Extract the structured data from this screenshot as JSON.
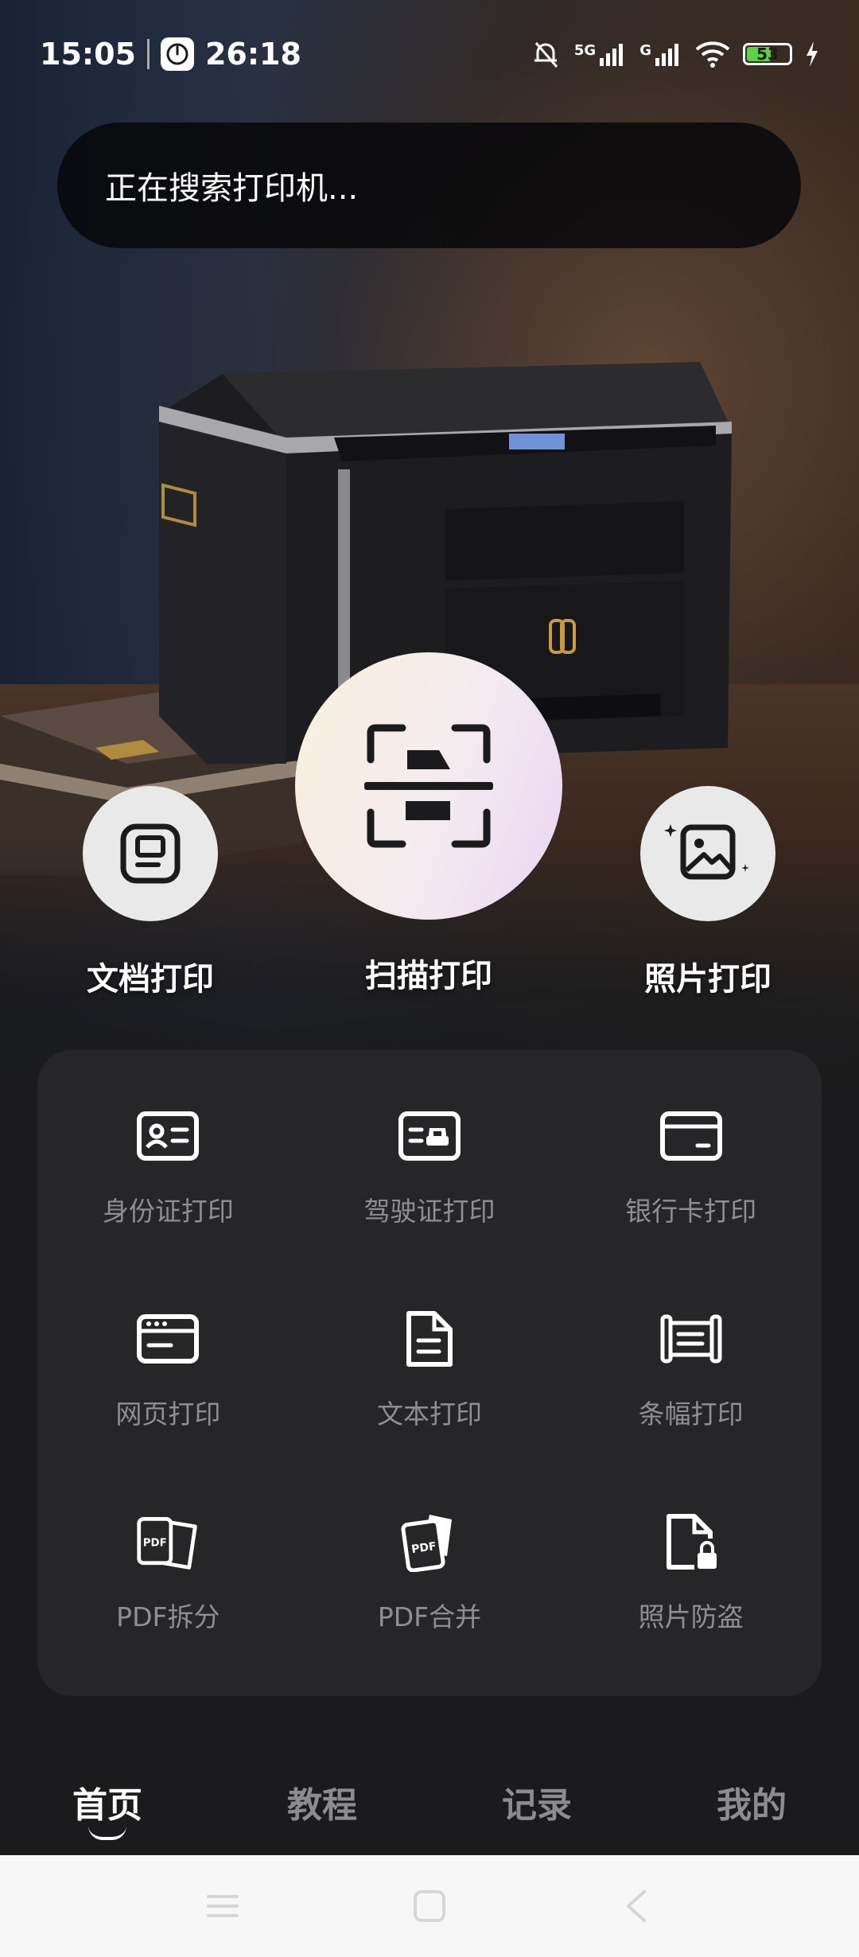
{
  "status_bar": {
    "time": "15:05",
    "timer": "26:18",
    "network_5g": "5G",
    "network_g": "G",
    "battery_level": "53",
    "battery_fraction": 0.53
  },
  "search": {
    "text": "正在搜索打印机..."
  },
  "primary_actions": [
    {
      "label": "文档打印",
      "icon": "document-icon"
    },
    {
      "label": "扫描打印",
      "icon": "scan-icon"
    },
    {
      "label": "照片打印",
      "icon": "photo-icon"
    }
  ],
  "features": [
    {
      "label": "身份证打印",
      "icon": "id-card-icon"
    },
    {
      "label": "驾驶证打印",
      "icon": "driver-license-icon"
    },
    {
      "label": "银行卡打印",
      "icon": "bank-card-icon"
    },
    {
      "label": "网页打印",
      "icon": "webpage-icon"
    },
    {
      "label": "文本打印",
      "icon": "text-file-icon"
    },
    {
      "label": "条幅打印",
      "icon": "banner-icon"
    },
    {
      "label": "PDF拆分",
      "icon": "pdf-split-icon",
      "icon_text": "PDF"
    },
    {
      "label": "PDF合并",
      "icon": "pdf-merge-icon",
      "icon_text": "PDF"
    },
    {
      "label": "照片防盗",
      "icon": "photo-lock-icon"
    }
  ],
  "bottom_nav": [
    {
      "label": "首页",
      "active": true
    },
    {
      "label": "教程",
      "active": false
    },
    {
      "label": "记录",
      "active": false
    },
    {
      "label": "我的",
      "active": false
    }
  ],
  "colors": {
    "accent_battery": "#5fd04a",
    "card_bg": "#262628",
    "label_gray": "#8f8f93"
  }
}
